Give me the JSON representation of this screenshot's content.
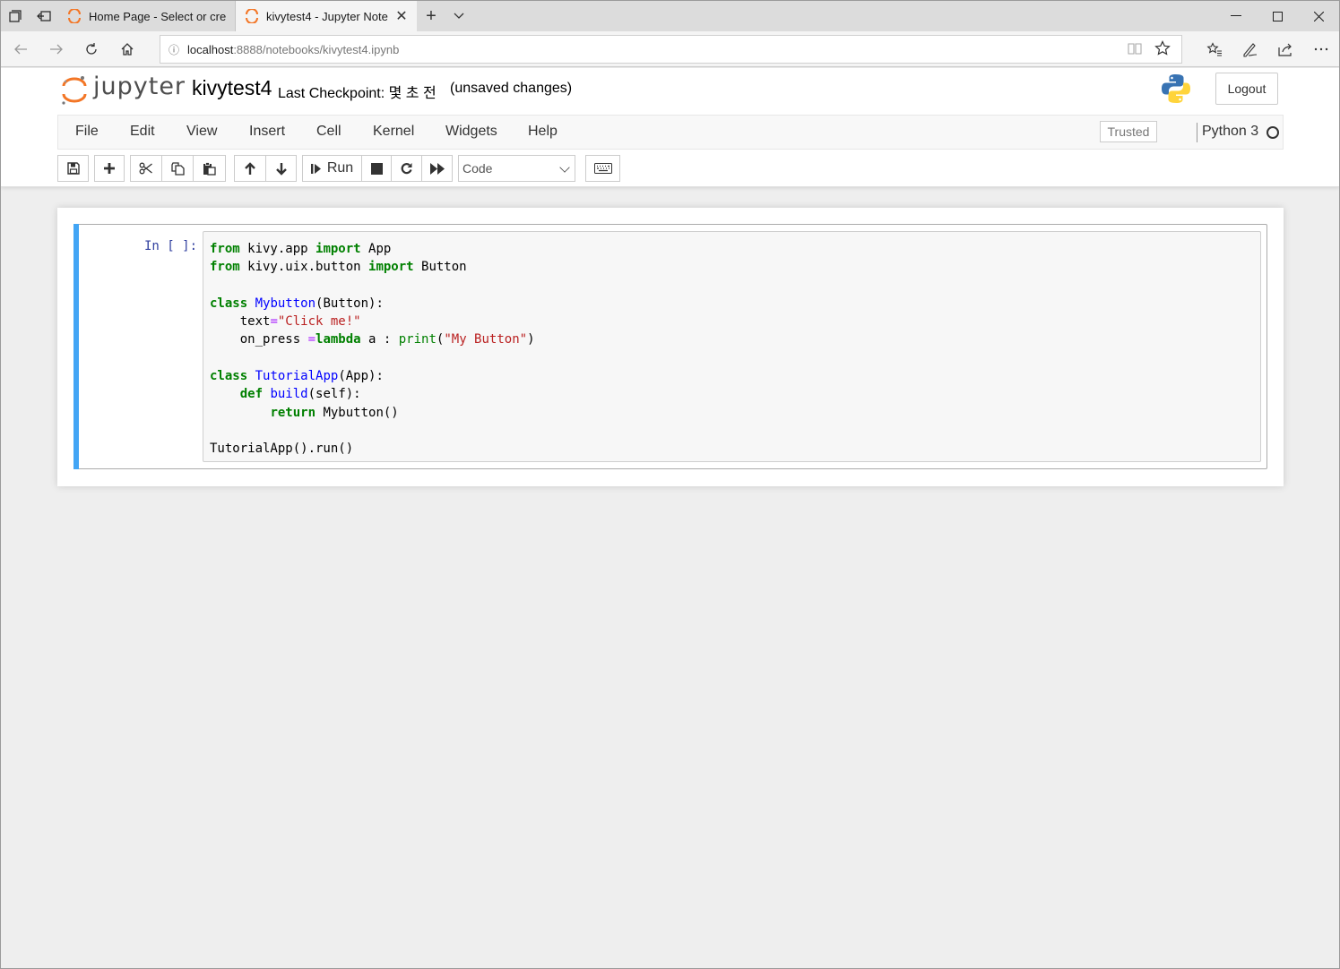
{
  "browser": {
    "tabs": [
      {
        "title": "Home Page - Select or creat",
        "active": false
      },
      {
        "title": "kivytest4 - Jupyter Note",
        "active": true
      }
    ],
    "address": {
      "host": "localhost",
      "path": ":8888/notebooks/kivytest4.ipynb"
    }
  },
  "header": {
    "logo_text": "jupyter",
    "notebook_name": "kivytest4",
    "checkpoint_text": "Last Checkpoint: 몇 초 전",
    "autosave_status": "(unsaved changes)",
    "logout_label": "Logout"
  },
  "menubar": {
    "items": [
      "File",
      "Edit",
      "View",
      "Insert",
      "Cell",
      "Kernel",
      "Widgets",
      "Help"
    ],
    "trusted_label": "Trusted",
    "kernel_name": "Python 3"
  },
  "toolbar": {
    "run_label": "Run",
    "cell_type": "Code"
  },
  "cell": {
    "prompt": "In [ ]:",
    "code_lines": [
      "from kivy.app import App",
      "from kivy.uix.button import Button",
      "",
      "class Mybutton(Button):",
      "    text=\"Click me!\"",
      "    on_press =lambda a : print(\"My Button\")",
      "",
      "class TutorialApp(App):",
      "    def build(self):",
      "        return Mybutton()",
      "",
      "TutorialApp().run()"
    ]
  },
  "colors": {
    "cell_selected_bar": "#42a5f5",
    "jupyter_orange": "#f37626",
    "keyword": "#008000",
    "string": "#ba2121",
    "definition": "#0000ff"
  }
}
